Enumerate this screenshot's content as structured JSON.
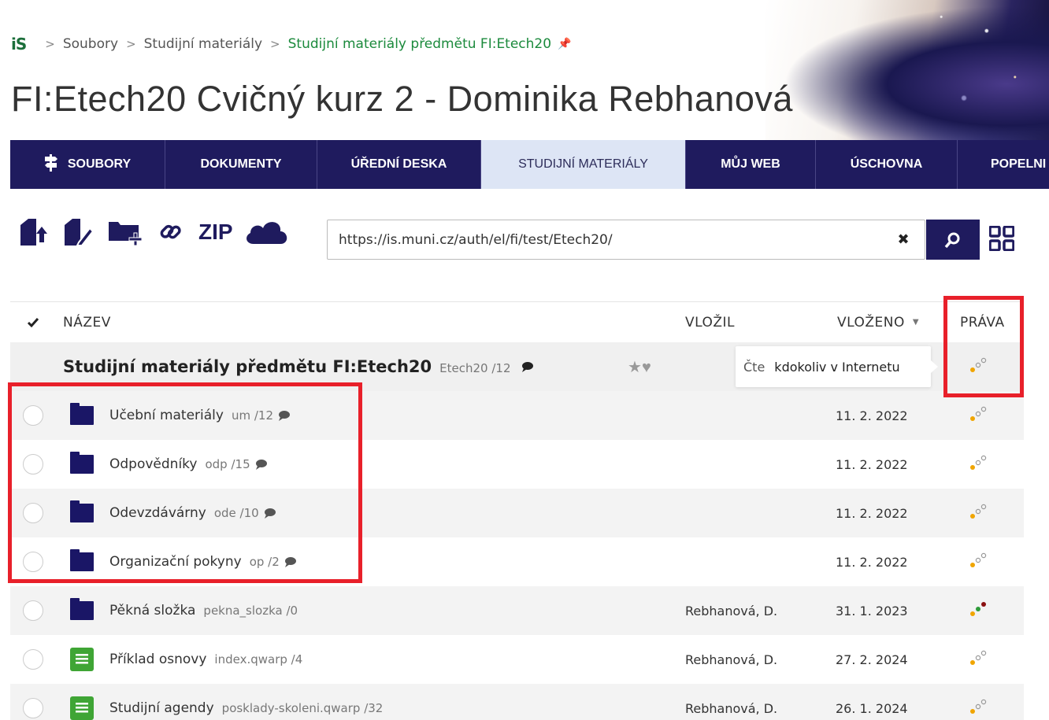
{
  "breadcrumb": {
    "logo": "iS",
    "items": [
      "Soubory",
      "Studijní materiály"
    ],
    "current": "Studijní materiály předmětu FI:Etech20"
  },
  "page_title": "FI:Etech20 Cvičný kurz 2 - Dominika Rebhanová",
  "nav": [
    {
      "label": "SOUBORY"
    },
    {
      "label": "DOKUMENTY"
    },
    {
      "label": "ÚŘEDNÍ DESKA"
    },
    {
      "label": "STUDIJNÍ MATERIÁLY",
      "active": true
    },
    {
      "label": "MŮJ WEB"
    },
    {
      "label": "ÚSCHOVNA"
    },
    {
      "label": "POPELNI"
    }
  ],
  "toolbar": {
    "zip_label": "ZIP",
    "url_value": "https://is.muni.cz/auth/el/fi/test/Etech20/"
  },
  "table": {
    "headers": {
      "name": "NÁZEV",
      "vlozil": "VLOŽIL",
      "vlozeno": "VLOŽENO",
      "prava": "PRÁVA"
    },
    "parent": {
      "name": "Studijní materiály předmětu FI:Etech20",
      "short": "Etech20 /12",
      "tooltip_label": "Čte",
      "tooltip_value": "kdokoliv v Internetu"
    },
    "rows": [
      {
        "type": "folder",
        "name": "Učební materiály",
        "short": "um /12",
        "comment": true,
        "vlozil": "",
        "date": "11. 2. 2022"
      },
      {
        "type": "folder",
        "name": "Odpovědníky",
        "short": "odp /15",
        "comment": true,
        "vlozil": "",
        "date": "11. 2. 2022"
      },
      {
        "type": "folder",
        "name": "Odevzdávárny",
        "short": "ode /10",
        "comment": true,
        "vlozil": "",
        "date": "11. 2. 2022"
      },
      {
        "type": "folder",
        "name": "Organizační pokyny",
        "short": "op /2",
        "comment": true,
        "vlozil": "",
        "date": "11. 2. 2022"
      },
      {
        "type": "folder",
        "name": "Pěkná složka",
        "short": "pekna_slozka /0",
        "comment": false,
        "vlozil": "Rebhanová, D.",
        "date": "31. 1. 2023"
      },
      {
        "type": "qwarp",
        "name": "Příklad osnovy",
        "short": "index.qwarp /4",
        "comment": false,
        "vlozil": "Rebhanová, D.",
        "date": "27. 2. 2024"
      },
      {
        "type": "qwarp",
        "name": "Studijní agendy",
        "short": "posklady-skoleni.qwarp /32",
        "comment": false,
        "vlozil": "Rebhanová, D.",
        "date": "26. 1. 2024"
      }
    ]
  },
  "colors": {
    "nav_bg": "#1f1b5e",
    "active_tab_bg": "#dde5f5",
    "highlight": "#e8202a",
    "breadcrumb_current": "#1b8a3c"
  }
}
